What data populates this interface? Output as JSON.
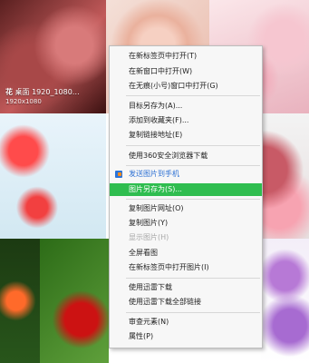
{
  "thumbnail_caption": {
    "title_prefix": "花",
    "title_rest": "桌面 1920_1080…",
    "size": "1920x1080"
  },
  "context_menu": {
    "items": [
      {
        "label": "在新标签页中打开(T)"
      },
      {
        "label": "在新窗口中打开(W)"
      },
      {
        "label": "在无痕(小号)窗口中打开(G)"
      },
      {
        "label": "目标另存为(A)..."
      },
      {
        "label": "添加到收藏夹(F)..."
      },
      {
        "label": "复制链接地址(E)"
      },
      {
        "label": "使用360安全浏览器下载"
      },
      {
        "label": "发送图片到手机",
        "icon": "phone-send-icon"
      },
      {
        "label": "图片另存为(S)..."
      },
      {
        "label": "复制图片网址(O)"
      },
      {
        "label": "复制图片(Y)"
      },
      {
        "label": "显示图片(H)"
      },
      {
        "label": "全屏看图"
      },
      {
        "label": "在新标签页中打开图片(I)"
      },
      {
        "label": "使用迅雷下载"
      },
      {
        "label": "使用迅雷下载全部链接"
      },
      {
        "label": "审查元素(N)"
      },
      {
        "label": "属性(P)"
      }
    ]
  },
  "colors": {
    "highlight": "#2fbd4f",
    "link_blue": "#2b6fd3",
    "disabled": "#a7a7a7"
  }
}
